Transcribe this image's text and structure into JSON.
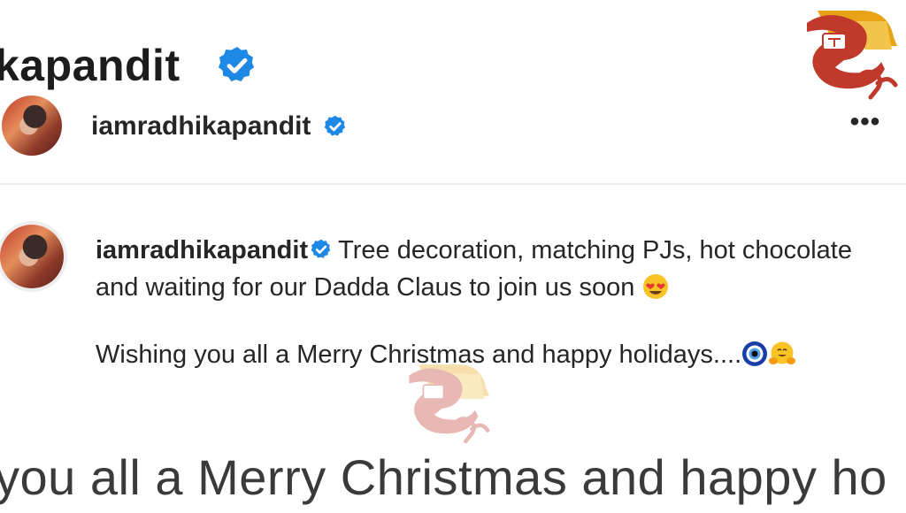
{
  "header_banner": {
    "username_fragment": "kapandit"
  },
  "post_header": {
    "username": "iamradhikapandit",
    "more_label": "•••"
  },
  "caption": {
    "username": "iamradhikapandit",
    "line1": "Tree decoration, matching PJs, hot chocolate and waiting for our Dadda Claus to join us soon",
    "line2": "Wishing you all a Merry Christmas and happy holidays....",
    "emojis": [
      "heart-eyes-emoji",
      "nazar-amulet-emoji",
      "hugging-face-emoji"
    ]
  },
  "bottom_zoom_text": "you all a Merry Christmas and happy ho",
  "colors": {
    "verified_blue": "#1e88e5",
    "text": "#262626",
    "logo_red": "#c0392b",
    "logo_gold": "#e8a317"
  },
  "icons": {
    "verified": "verified-badge-icon",
    "more": "more-options-icon",
    "logo": "tv-channel-logo"
  }
}
